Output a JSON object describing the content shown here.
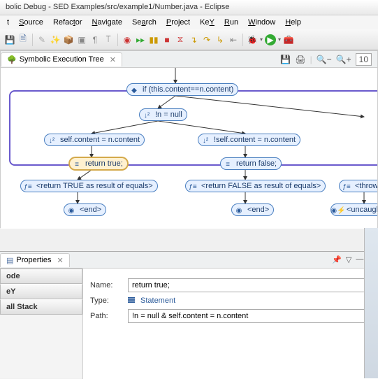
{
  "title": "bolic Debug - SED Examples/src/example1/Number.java - Eclipse",
  "menus": [
    "t",
    "Source",
    "Refactor",
    "Navigate",
    "Search",
    "Project",
    "KeY",
    "Run",
    "Window",
    "Help"
  ],
  "view": {
    "tab": "Symbolic Execution Tree",
    "zoom": "10"
  },
  "nodes": {
    "if": "if (this.content==n.content)",
    "notnull": "!n = null",
    "selfeq": "self.content = n.content",
    "notselfeq": "!self.content = n.content",
    "rettrue": "return true;",
    "retfalse": "return false;",
    "rTRUE": "<return TRUE as result of equals>",
    "rFALSE": "<return FALSE as result of equals>",
    "throw": "<throw  java",
    "end1": "<end>",
    "end2": "<end>",
    "uncaught": "<uncaught jav"
  },
  "props": {
    "tab": "Properties",
    "cats": {
      "node": "ode",
      "key": "eY",
      "call": "all Stack"
    },
    "name_lbl": "Name:",
    "name_val": "return true;",
    "type_lbl": "Type:",
    "type_val": "Statement",
    "path_lbl": "Path:",
    "path_val": "!n = null & self.content = n.content"
  }
}
